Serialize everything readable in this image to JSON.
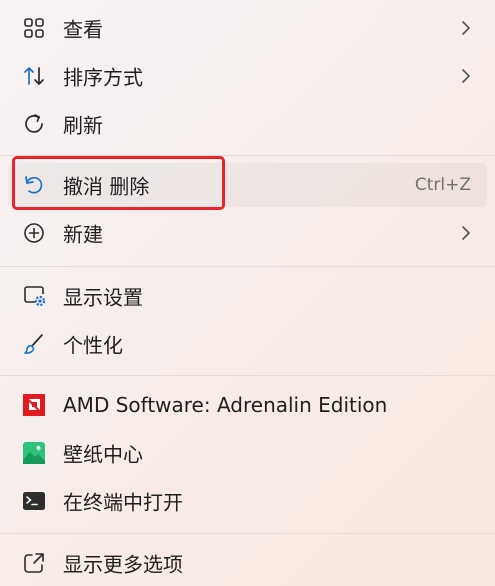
{
  "menu": {
    "items": [
      {
        "label": "查看",
        "icon": "grid-view-icon",
        "submenu": true
      },
      {
        "label": "排序方式",
        "icon": "sort-arrows-icon",
        "submenu": true
      },
      {
        "label": "刷新",
        "icon": "refresh-icon",
        "submenu": false
      },
      {
        "label": "撤消 删除",
        "icon": "undo-icon",
        "shortcut": "Ctrl+Z"
      },
      {
        "label": "新建",
        "icon": "add-circle-icon",
        "submenu": true
      },
      {
        "label": "显示设置",
        "icon": "display-settings-icon"
      },
      {
        "label": "个性化",
        "icon": "brush-icon"
      },
      {
        "label": "AMD Software: Adrenalin Edition",
        "icon": "amd-logo-icon"
      },
      {
        "label": "壁纸中心",
        "icon": "wallpaper-center-icon"
      },
      {
        "label": "在终端中打开",
        "icon": "terminal-icon"
      },
      {
        "label": "显示更多选项",
        "icon": "open-external-icon"
      }
    ]
  },
  "colors": {
    "highlight_border": "#e8262a",
    "accent_blue": "#1a73c8",
    "amd_red": "#e11b22",
    "wallpaper_green": "#2fc27a"
  }
}
